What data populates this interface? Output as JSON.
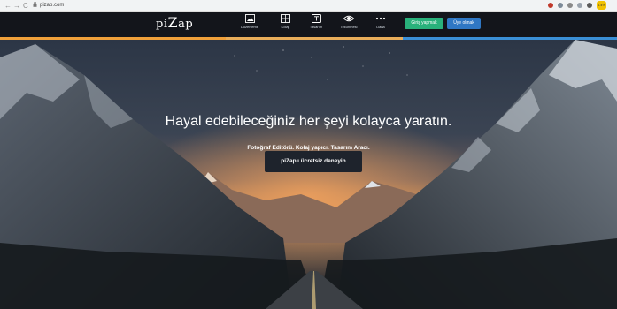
{
  "browser": {
    "url": "pizap.com",
    "back_glyph": "←",
    "forward_glyph": "→",
    "reload_glyph": "C",
    "profile_label": "4.4%"
  },
  "header": {
    "logo_pi": "pi",
    "logo_z": "Z",
    "logo_ap": "ap",
    "nav": [
      {
        "label": "Düzenleme",
        "icon": "photo-icon"
      },
      {
        "label": "Kolaj",
        "icon": "collage-grid-icon"
      },
      {
        "label": "Tasarım",
        "icon": "text-design-icon"
      },
      {
        "label": "Tekünmesi",
        "icon": "eye-icon"
      },
      {
        "label": "Daha",
        "icon": "more-dots-icon"
      }
    ],
    "login_label": "Giriş yapmak",
    "signup_label": "Üye olmak"
  },
  "colors": {
    "header_bg": "#13151b",
    "login_green": "#29b17b",
    "signup_blue": "#2f77c4",
    "accent_orange": "#f0a03a",
    "accent_blue": "#3a8fd6"
  },
  "hero": {
    "headline": "Hayal edebileceğiniz her şeyi kolayca yaratın.",
    "subline": "Fotoğraf Editörü. Kolaj yapıcı. Tasarım Aracı.",
    "cta_label": "piZap'ı ücretsiz deneyin"
  }
}
